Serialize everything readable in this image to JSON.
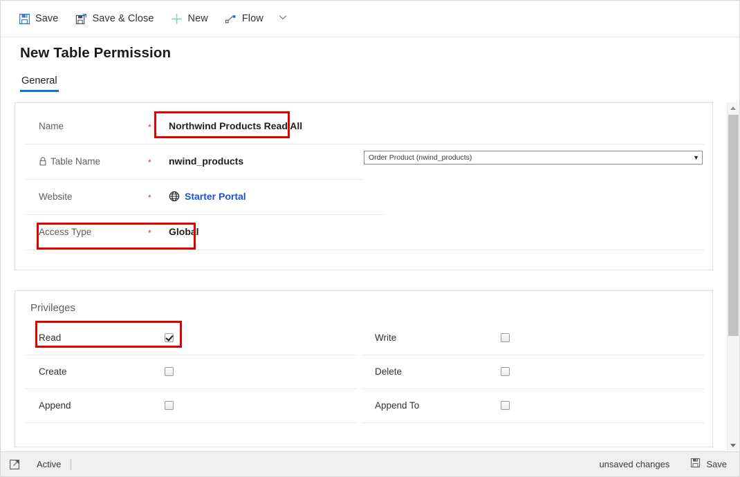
{
  "window": {
    "title": "New Table Permission"
  },
  "command_bar": {
    "items": [
      {
        "label": "Save",
        "icon": "save-floppy-icon"
      },
      {
        "label": "Save & Close",
        "icon": "save-and-close-floppy-icon"
      },
      {
        "label": "New",
        "icon": "plus-icon"
      },
      {
        "label": "Flow",
        "icon": "flow-icon"
      }
    ],
    "overflow_icon": "chevron-down-icon"
  },
  "tabs": [
    {
      "label": "General",
      "active": true
    }
  ],
  "general": {
    "fields": [
      {
        "label": "Name",
        "required": "*",
        "value": "Northwind Products Read All",
        "locked": false,
        "highlighted": true
      },
      {
        "label": "Table Name",
        "required": "*",
        "value": "nwind_products",
        "locked": true,
        "lock_icon": "lock-icon",
        "highlighted": false
      },
      {
        "label": "Website",
        "required": "*",
        "value": "Starter Portal",
        "value_is_link": true,
        "icon": "globe-icon",
        "locked": false,
        "highlighted": false
      },
      {
        "label": "Access Type",
        "required": "*",
        "value": "Global",
        "locked": false,
        "highlighted": true
      }
    ],
    "lookup": {
      "value": "Order Product (nwind_products)",
      "arrow_icon": "dropdown-arrow-icon"
    }
  },
  "privileges": {
    "title": "Privileges",
    "left_column": [
      {
        "label": "Read",
        "checked": true,
        "highlighted": true
      },
      {
        "label": "Create",
        "checked": false,
        "highlighted": false
      },
      {
        "label": "Append",
        "checked": false,
        "highlighted": false
      }
    ],
    "right_column": [
      {
        "label": "Write",
        "checked": false,
        "highlighted": false
      },
      {
        "label": "Delete",
        "checked": false,
        "highlighted": false
      },
      {
        "label": "Append To",
        "checked": false,
        "highlighted": false
      }
    ]
  },
  "footer": {
    "popout_icon": "open-in-new-window-icon",
    "status": "Active",
    "unsaved": "unsaved changes",
    "save_label": "Save",
    "save_icon": "save-floppy-icon"
  },
  "colors": {
    "accent": "#0078d4",
    "link": "#1f4fd8",
    "required": "#d13438",
    "highlight": "#e00000",
    "new_icon": "#8fd4b0"
  },
  "scrollbar": {
    "up_icon": "scroll-up-arrow-icon",
    "down_icon": "scroll-down-arrow-icon"
  }
}
